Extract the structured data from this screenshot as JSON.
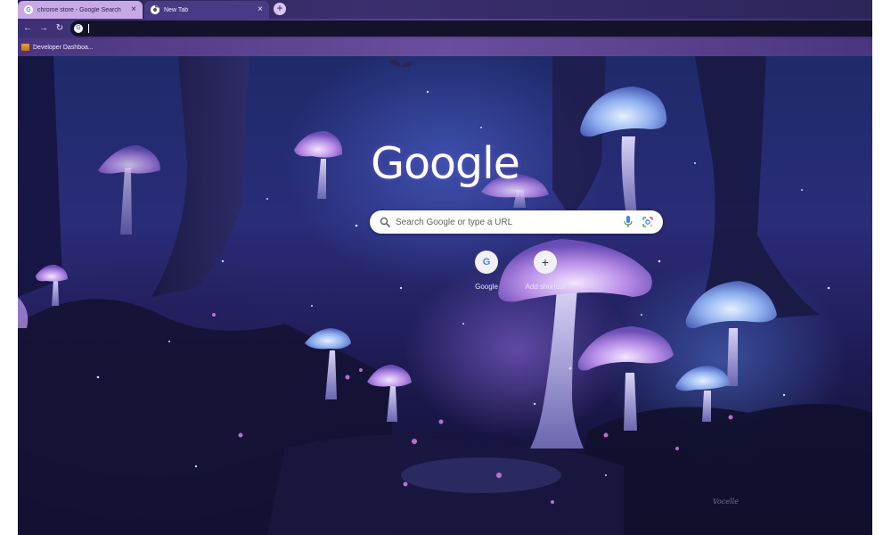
{
  "tabs": [
    {
      "title": "chrome store - Google Search",
      "favicon": "google-g-icon",
      "active": false
    },
    {
      "title": "New Tab",
      "favicon": "chrome-icon",
      "active": true
    }
  ],
  "toolbar": {
    "back_icon": "back-arrow-icon",
    "forward_icon": "forward-arrow-icon",
    "reload_icon": "reload-icon",
    "omnibox_value": ""
  },
  "bookmarks": [
    {
      "label": "Developer Dashboa...",
      "icon": "bookmark-favicon"
    }
  ],
  "ntp": {
    "logo": "Google",
    "search_placeholder": "Search Google or type a URL",
    "shortcuts": [
      {
        "label": "Google",
        "icon": "G"
      },
      {
        "label": "Add shortcut",
        "icon": "+"
      }
    ],
    "signature": "Vocelle"
  },
  "colors": {
    "tab_inactive": "#c8a8e6",
    "tab_active": "#4a3a86",
    "toolbar": "#5a4596",
    "omnibox": "#14122a",
    "page_bg": "#1e2a6a"
  }
}
